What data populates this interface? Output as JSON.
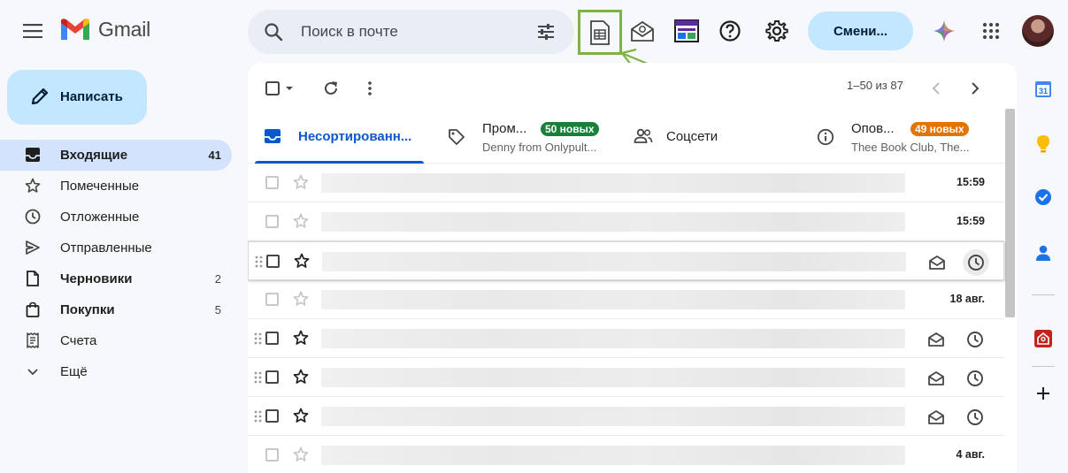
{
  "header": {
    "logo_text": "Gmail",
    "search_placeholder": "Поиск в почте",
    "switch_button": "Смени..."
  },
  "compose": {
    "label": "Написать"
  },
  "nav": [
    {
      "label": "Входящие",
      "count": "41",
      "icon": "inbox-icon",
      "active": true
    },
    {
      "label": "Помеченные",
      "count": "",
      "icon": "star-icon"
    },
    {
      "label": "Отложенные",
      "count": "",
      "icon": "clock-icon"
    },
    {
      "label": "Отправленные",
      "count": "",
      "icon": "send-icon"
    },
    {
      "label": "Черновики",
      "count": "2",
      "icon": "draft-icon",
      "bold": true
    },
    {
      "label": "Покупки",
      "count": "5",
      "icon": "shopping-bag-icon",
      "bold": true
    },
    {
      "label": "Счета",
      "count": "",
      "icon": "receipt-icon"
    },
    {
      "label": "Ещё",
      "count": "",
      "icon": "chevron-down-icon"
    }
  ],
  "toolbar": {
    "pager": "1–50 из 87"
  },
  "tabs": [
    {
      "label": "Несортированн...",
      "sub": "",
      "badge": "",
      "icon": "inbox-tab-icon",
      "active": true
    },
    {
      "label": "Пром...",
      "sub": "Denny from Onlypult...",
      "badge": "50 новых",
      "badge_color": "#188038",
      "icon": "tag-icon"
    },
    {
      "label": "Соцсети",
      "sub": "",
      "badge": "",
      "icon": "people-icon"
    },
    {
      "label": "Опов...",
      "sub": "Thee Book Club, The...",
      "badge": "49 новых",
      "badge_color": "#e37400",
      "icon": "info-icon"
    }
  ],
  "rows": [
    {
      "date": "15:59",
      "hover": false
    },
    {
      "date": "15:59",
      "hover": false
    },
    {
      "date": "",
      "hover": true
    },
    {
      "date": "18 авг.",
      "hover": false
    },
    {
      "date": "",
      "hover": true
    },
    {
      "date": "",
      "hover": true
    },
    {
      "date": "",
      "hover": true
    },
    {
      "date": "4 авг.",
      "hover": false
    }
  ],
  "side_panel": {
    "calendar_day": "31"
  }
}
